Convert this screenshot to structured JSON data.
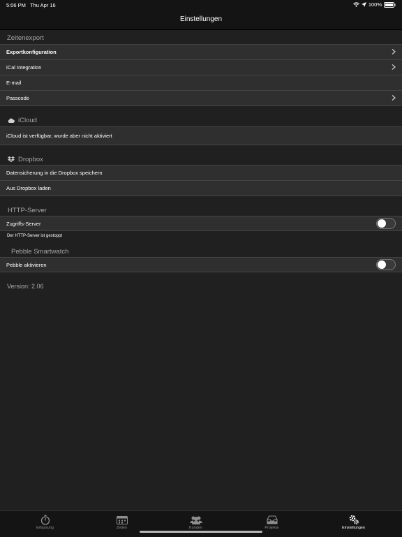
{
  "status_bar": {
    "time": "5:06 PM",
    "date": "Thu Apr 16",
    "battery": "100%"
  },
  "nav": {
    "title": "Einstellungen"
  },
  "sections": {
    "zeitenexport": {
      "header": "Zeitenexport",
      "rows": [
        "Exportkonfiguration",
        "iCal Integration",
        "E-mail",
        "Passcode"
      ]
    },
    "icloud": {
      "header": "iCloud",
      "rows": [
        "iCloud ist verfügbar, wurde aber nicht aktiviert"
      ]
    },
    "dropbox": {
      "header": "Dropbox",
      "rows": [
        "Datensicherung in die Dropbox speichern",
        "Aus Dropbox laden"
      ]
    },
    "http_server": {
      "header": "HTTP-Server",
      "row": "Zugriffs-Server",
      "toggle_on": false,
      "footnote": "Der HTTP-Server ist gestoppt"
    },
    "pebble": {
      "header": "Pebble Smartwatch",
      "row": "Pebble aktivieren",
      "toggle_on": false
    }
  },
  "version": "Version: 2.06",
  "tabs": [
    {
      "label": "Erfassung",
      "icon": "stopwatch-icon"
    },
    {
      "label": "Zeiten",
      "icon": "calendar-icon"
    },
    {
      "label": "Kunden",
      "icon": "people-icon"
    },
    {
      "label": "Projekte",
      "icon": "inbox-icon"
    },
    {
      "label": "Einstellungen",
      "icon": "gears-icon",
      "active": true
    }
  ],
  "colors": {
    "background": "#202020",
    "row": "#2f2f2f",
    "header_text": "#a6a6a6",
    "bar": "#141414"
  }
}
